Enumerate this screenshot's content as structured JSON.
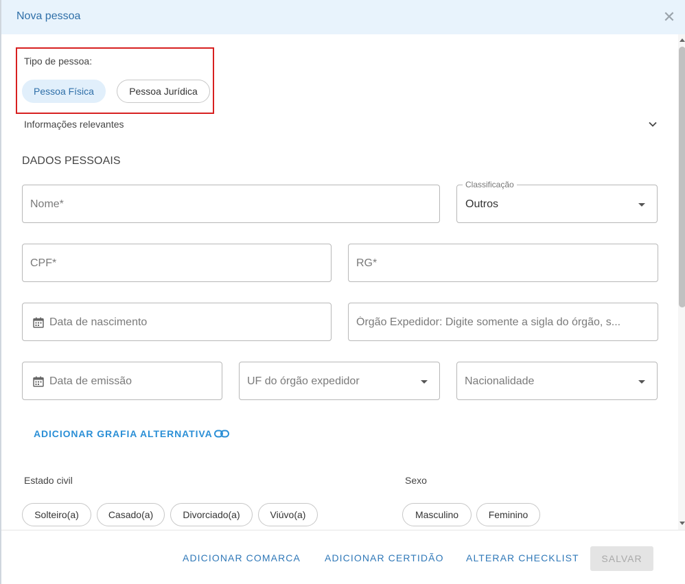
{
  "dialog": {
    "title": "Nova pessoa",
    "close_symbol": "✕"
  },
  "tipo_pessoa": {
    "label": "Tipo de pessoa:",
    "options": [
      "Pessoa Física",
      "Pessoa Jurídica"
    ],
    "selected": "Pessoa Física"
  },
  "info_section": {
    "label": "Informações relevantes",
    "expanded": false
  },
  "dados_pessoais": {
    "title": "DADOS PESSOAIS",
    "nome": {
      "placeholder": "Nome*"
    },
    "classificacao": {
      "legend": "Classificação",
      "value": "Outros"
    },
    "cpf": {
      "placeholder": "CPF*"
    },
    "rg": {
      "placeholder": "RG*"
    },
    "data_nascimento": {
      "placeholder": "Data de nascimento"
    },
    "orgao_expedidor": {
      "placeholder": "Órgão Expedidor: Digite somente a sigla do órgão, s..."
    },
    "data_emissao": {
      "placeholder": "Data de emissão"
    },
    "uf_orgao": {
      "placeholder": "UF do órgão expedidor"
    },
    "nacionalidade": {
      "placeholder": "Nacionalidade"
    },
    "grafia_link": "ADICIONAR GRAFIA ALTERNATIVA"
  },
  "estado_civil": {
    "label": "Estado civil",
    "options": [
      "Solteiro(a)",
      "Casado(a)",
      "Divorciado(a)",
      "Viúvo(a)"
    ]
  },
  "sexo": {
    "label": "Sexo",
    "options": [
      "Masculino",
      "Feminino"
    ]
  },
  "footer": {
    "adicionar_comarca": "ADICIONAR COMARCA",
    "adicionar_certidao": "ADICIONAR CERTIDÃO",
    "alterar_checklist": "ALTERAR CHECKLIST",
    "salvar": "SALVAR"
  },
  "colors": {
    "header_bg": "#e8f3fc",
    "title": "#2f6fa8",
    "chip_active_bg": "#e1effb",
    "highlight_border": "#d71f1f",
    "link": "#2b8fd6"
  },
  "icons": [
    "close-icon",
    "chevron-down-icon",
    "calendar-icon",
    "link-icon",
    "dropdown-caret-icon"
  ]
}
